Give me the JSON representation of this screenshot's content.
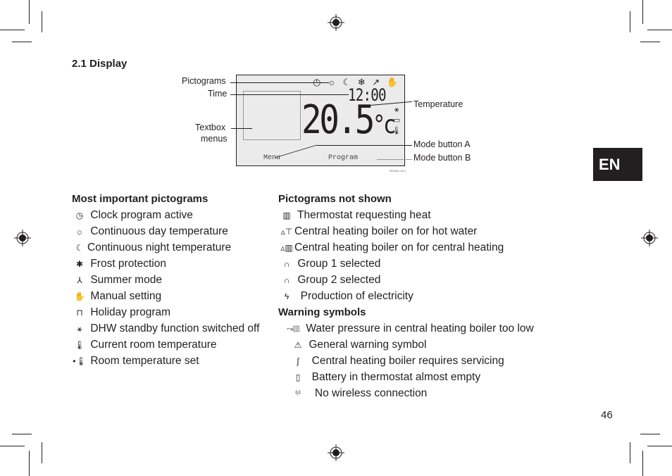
{
  "section_title": "2.1  Display",
  "display_figure": {
    "lcd": {
      "pictograms_row": [
        "clock-icon",
        "sun-icon",
        "moon-icon",
        "snowflake-icon",
        "summer-icon",
        "hand-icon"
      ],
      "pictogram_glyphs": "◷ ☼ ☾ ❄ ↗ ✋",
      "time": "12:00",
      "temperature": "20.5",
      "unit": "°c",
      "side_glyphs": [
        "⚹",
        "▭",
        "🌡"
      ],
      "softkey_a": "Menu",
      "softkey_b": "Program",
      "figure_code": "TB0880-08-A"
    },
    "callouts_left": [
      "Pictograms",
      "Time",
      "Textbox",
      "menus"
    ],
    "callouts_right": [
      "Temperature",
      "Mode button A",
      "Mode button B"
    ]
  },
  "most_important": {
    "title": "Most important pictograms",
    "items": [
      {
        "icon": "clock-icon",
        "glyph": "◷",
        "label": "Clock program active"
      },
      {
        "icon": "sun-icon",
        "glyph": "☼",
        "label": "Continuous day temperature"
      },
      {
        "icon": "moon-icon",
        "glyph": "☾",
        "label": "Continuous night temperature"
      },
      {
        "icon": "frost-icon",
        "glyph": "✱",
        "label": "Frost protection"
      },
      {
        "icon": "summer-icon",
        "glyph": "⅄",
        "label": "Summer mode"
      },
      {
        "icon": "hand-icon",
        "glyph": "✋",
        "label": "Manual setting"
      },
      {
        "icon": "suitcase-icon",
        "glyph": "⊓",
        "label": "Holiday program"
      },
      {
        "icon": "dhw-off-icon",
        "glyph": "⚹",
        "label": "DHW standby function switched off"
      },
      {
        "icon": "thermometer-icon",
        "glyph": "🌡",
        "label": "Current room temperature"
      },
      {
        "icon": "thermometer-set-icon",
        "glyph": "•🌡",
        "label": "Room temperature set"
      }
    ]
  },
  "not_shown": {
    "title": "Pictograms not shown",
    "items": [
      {
        "icon": "radiator-icon",
        "glyph": "▥",
        "label": "Thermostat requesting heat"
      },
      {
        "icon": "boiler-tap-icon",
        "glyph": "▵⊤",
        "label": "Central heating boiler on for hot water"
      },
      {
        "icon": "boiler-radiator-icon",
        "glyph": "▵▥",
        "label": "Central heating boiler on for central heating"
      },
      {
        "icon": "group1-icon",
        "glyph": "∩",
        "label": "Group 1 selected"
      },
      {
        "icon": "group2-icon",
        "glyph": "∩",
        "label": "Group 2 selected"
      },
      {
        "icon": "lightning-icon",
        "glyph": "ϟ",
        "label": "Production of electricity"
      }
    ]
  },
  "warnings": {
    "title": "Warning symbols",
    "items": [
      {
        "icon": "low-pressure-icon",
        "glyph": "⤳▥",
        "label": "Water pressure in central heating boiler too low"
      },
      {
        "icon": "warning-triangle-icon",
        "glyph": "⚠",
        "label": "General warning symbol"
      },
      {
        "icon": "wrench-icon",
        "glyph": "∫",
        "label": "Central heating boiler requires servicing"
      },
      {
        "icon": "battery-icon",
        "glyph": "▯",
        "label": "Battery in thermostat almost empty"
      },
      {
        "icon": "no-wireless-icon",
        "glyph": "⁽ᵎ⁾",
        "label": "No wireless connection"
      }
    ]
  },
  "language_tab": "EN",
  "page_number": "46"
}
